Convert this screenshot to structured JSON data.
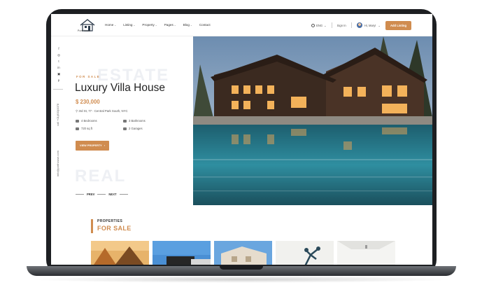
{
  "header": {
    "logo_text": "PortHouse",
    "nav": [
      {
        "label": "Home",
        "dropdown": true
      },
      {
        "label": "Listing",
        "dropdown": true
      },
      {
        "label": "Property",
        "dropdown": true
      },
      {
        "label": "Pages",
        "dropdown": true
      },
      {
        "label": "Blog",
        "dropdown": true
      },
      {
        "label": "Contact",
        "dropdown": false
      }
    ],
    "language": "ENG",
    "sign_in": "Sign In",
    "user_name": "Hi, Mary!",
    "add_listing": "Add Listing"
  },
  "social_icons": [
    "f",
    "◎",
    "t",
    "in",
    "▣",
    "p"
  ],
  "sidebar": {
    "phone": "call +01(800)0078",
    "email": "info@porthouse.com"
  },
  "hero": {
    "ghost_top": "ESTATE",
    "ghost_bottom": "REAL",
    "tag": "FOR SALE",
    "title": "Luxury Villa House",
    "price": "$ 230,000",
    "address": "3rd St, 77 - Central Park South, NYC",
    "features": [
      {
        "icon": "bed-icon",
        "label": "4 Bedrooms"
      },
      {
        "icon": "bath-icon",
        "label": "3 Bathrooms"
      },
      {
        "icon": "area-icon",
        "label": "720 sq ft"
      },
      {
        "icon": "garage-icon",
        "label": "2 Garages"
      }
    ],
    "view_button": "VIEW PROPERTY",
    "prev": "PREV",
    "next": "NEXT"
  },
  "properties": {
    "label": "PROPERTIES",
    "title": "FOR SALE"
  },
  "colors": {
    "accent": "#d08c4f",
    "text_dark": "#222222",
    "frame": "#1d1f22"
  }
}
